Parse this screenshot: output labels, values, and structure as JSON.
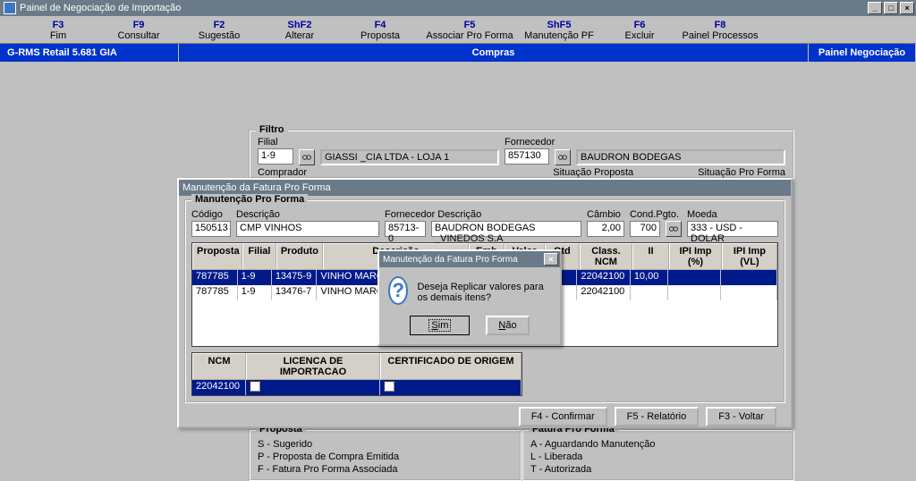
{
  "window": {
    "title": "Painel de Negociação de Importação"
  },
  "fkeys": [
    {
      "key": "F3",
      "label": "Fim"
    },
    {
      "key": "F9",
      "label": "Consultar"
    },
    {
      "key": "F2",
      "label": "Sugestão"
    },
    {
      "key": "ShF2",
      "label": "Alterar"
    },
    {
      "key": "F4",
      "label": "Proposta"
    },
    {
      "key": "F5",
      "label": "Associar Pro Forma"
    },
    {
      "key": "ShF5",
      "label": "Manutenção PF"
    },
    {
      "key": "F6",
      "label": "Excluir"
    },
    {
      "key": "F8",
      "label": "Painel Processos"
    }
  ],
  "bluebar": {
    "left": "G-RMS Retail 5.681 GIA",
    "center": "Compras",
    "right": "Painel Negociação"
  },
  "filtro": {
    "legend": "Filtro",
    "filial_label": "Filial",
    "filial_code": "1-9",
    "filial_name": "GIASSI _CIA LTDA - LOJA 1",
    "fornecedor_label": "Fornecedor",
    "fornecedor_code": "857130",
    "fornecedor_name": "BAUDRON BODEGAS",
    "comprador_label": "Comprador",
    "sit_proposta_label": "Situação Proposta",
    "sit_proforma_label": "Situação Pro Forma"
  },
  "dlg": {
    "title": "Manutenção da Fatura Pro Forma",
    "group_legend": "Manutenção Pro Forma",
    "codigo_label": "Código",
    "codigo": "150513",
    "desc_label": "Descrição",
    "desc": "CMP VINHOS",
    "forn_desc_label": "Fornecedor Descrição",
    "forn_code": "85713-0",
    "forn_name": "BAUDRON BODEGAS _VINEDOS S.A",
    "cambio_label": "Câmbio",
    "cambio": "2,00",
    "condpgto_label": "Cond.Pgto.",
    "condpgto": "700",
    "moeda_label": "Moeda",
    "moeda": "333 - USD - DOLAR",
    "grid_headers": {
      "proposta": "Proposta",
      "filial": "Filial",
      "produto": "Produto",
      "desc": "Descrição",
      "emb": "Emb",
      "valor": "Valor",
      "qtd": "Qtd",
      "ncm": "Class. NCM",
      "ii": "II",
      "ipip": "IPI Imp (%)",
      "ipiv": "IPI Imp (VL)"
    },
    "rows": [
      {
        "proposta": "787785",
        "filial": "1-9",
        "produto": "13475-9",
        "desc": "VINHO MARQUES DE LA MOTA SYRAH...",
        "emb": "",
        "valor": "",
        "qtd": "",
        "ncm": "22042100",
        "ii": "10,00",
        "ipip": "",
        "ipiv": ""
      },
      {
        "proposta": "787785",
        "filial": "1-9",
        "produto": "13476-7",
        "desc": "VINHO MARQUES DE",
        "emb": "",
        "valor": "",
        "qtd": "",
        "ncm": "22042100",
        "ii": "",
        "ipip": "",
        "ipiv": ""
      }
    ],
    "small_headers": {
      "ncm": "NCM",
      "lic": "LICENCA DE IMPORTACAO",
      "cert": "CERTIFICADO DE ORIGEM"
    },
    "small_row": {
      "ncm": "22042100"
    },
    "btn_confirmar": "F4 - Confirmar",
    "btn_relatorio": "F5 - Relatório",
    "btn_voltar": "F3 - Voltar"
  },
  "msgbox": {
    "title": "Manutenção da Fatura Pro Forma",
    "text": "Deseja Replicar valores para os demais itens?",
    "sim": "Sim",
    "nao": "Não"
  },
  "legend_back": {
    "proposta_legend": "Proposta",
    "p1": "S - Sugerido",
    "p2": "P - Proposta de Compra Emitida",
    "p3": "F - Fatura Pro Forma Associada",
    "fatura_legend": "Fatura Pro Forma",
    "f1": "A - Aguardando Manutenção",
    "f2": "L - Liberada",
    "f3": "T - Autorizada"
  }
}
